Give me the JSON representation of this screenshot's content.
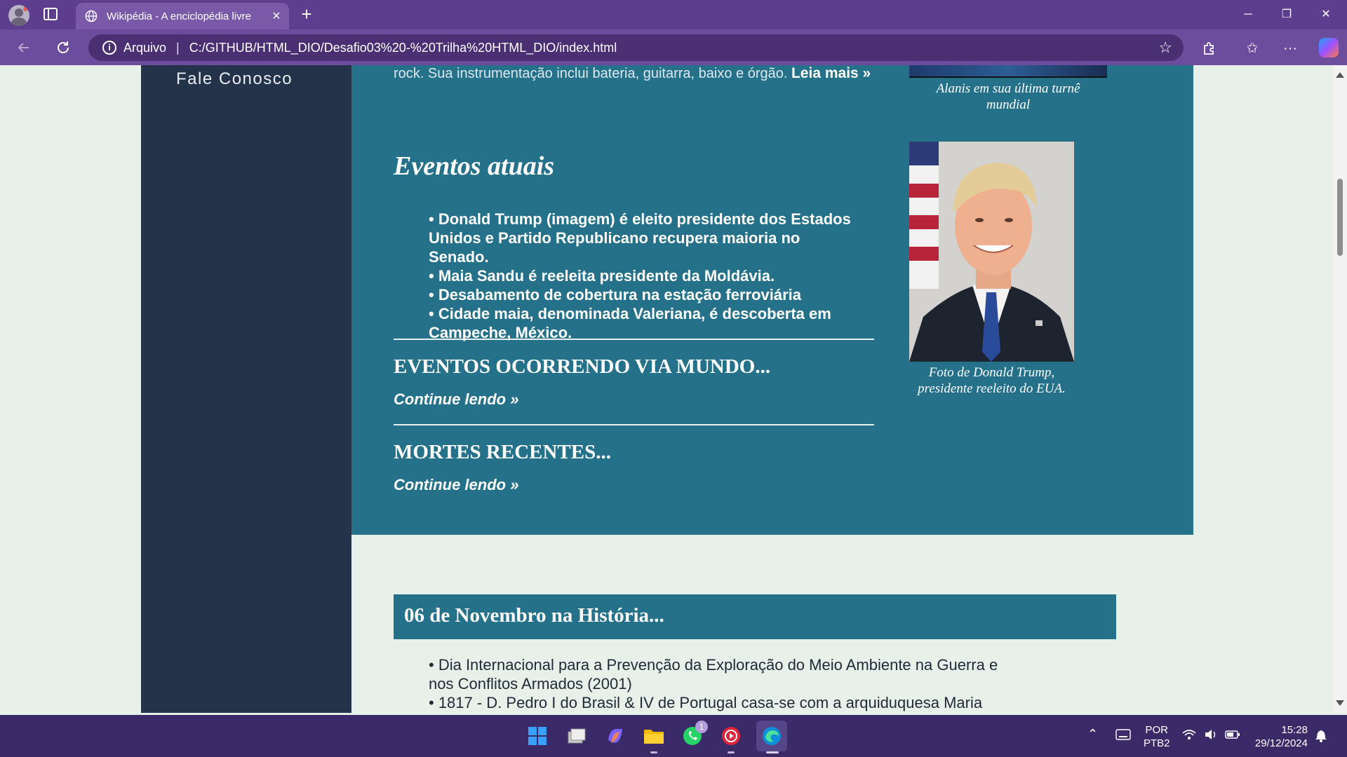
{
  "browser": {
    "tab_title": "Wikipédia - A enciclopédia livre",
    "tab_close": "×",
    "new_tab": "+",
    "address_scheme_label": "Arquivo",
    "address_separator": "|",
    "url": "C:/GITHUB/HTML_DIO/Desafio03%20-%20Trilha%20HTML_DIO/index.html",
    "win_minimize": "─",
    "win_restore": "❐",
    "win_close": "✕"
  },
  "sidebar": {
    "link_label": "Fale Conosco"
  },
  "main": {
    "top_text": "rock. Sua instrumentação inclui bateria, guitarra, baixo e órgão.",
    "top_link": "Leia mais »",
    "alanis_caption_line1": "Alanis em sua última turnê",
    "alanis_caption_line2": "mundial",
    "events_heading": "Eventos atuais",
    "events": [
      "• Donald Trump (imagem) é eleito presidente dos Estados Unidos e Partido Republicano recupera maioria no Senado.",
      "• Maia Sandu é reeleita presidente da Moldávia.",
      "• Desabamento de cobertura na estação ferroviária",
      "• Cidade maia, denominada Valeriana, é descoberta em Campeche, México."
    ],
    "section1_heading": "EVENTOS OCORRENDO VIA MUNDO...",
    "section1_link": "Continue lendo »",
    "section2_heading": "MORTES RECENTES...",
    "section2_link": "Continue lendo »",
    "trump_caption_line1": "Foto de Donald Trump,",
    "trump_caption_line2": "presidente reeleito do EUA."
  },
  "history": {
    "title": "06 de Novembro na História...",
    "items": [
      "• Dia Internacional para a Prevenção da Exploração do Meio Ambiente na Guerra e nos Conflitos Armados (2001)",
      "• 1817 - D. Pedro I do Brasil & IV de Portugal casa-se com a arquiduquesa Maria"
    ]
  },
  "taskbar": {
    "whatsapp_badge": "1",
    "lang_line1": "POR",
    "lang_line2": "PTB2",
    "time": "15:28",
    "date": "29/12/2024"
  },
  "colors": {
    "titlebar": "#5c3d8e",
    "main_block": "#25718a",
    "sidebar": "#243349",
    "page_bg": "#e8f0ea"
  }
}
